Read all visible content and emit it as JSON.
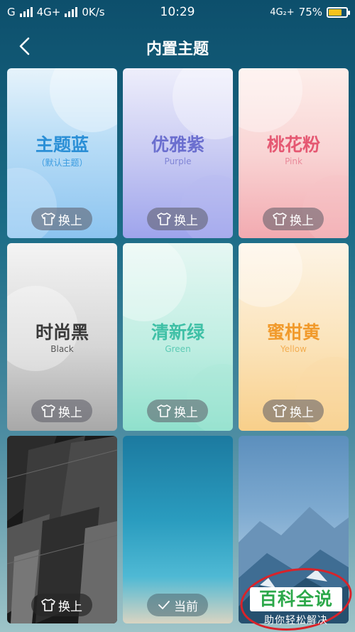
{
  "status_bar": {
    "carrier1": "G",
    "carrier2": "4G+",
    "speed": "0K/s",
    "time": "10:29",
    "network": "4G₂+",
    "battery": "75%",
    "battery_level": 0.75
  },
  "header": {
    "title": "内置主题"
  },
  "themes": [
    {
      "name": "主题蓝",
      "subtitle": "（默认主题）",
      "button": "换上",
      "name_color": "#2b8fd6"
    },
    {
      "name": "优雅紫",
      "subtitle": "Purple",
      "button": "换上",
      "name_color": "#6b6fcf"
    },
    {
      "name": "桃花粉",
      "subtitle": "Pink",
      "button": "换上",
      "name_color": "#e55872"
    },
    {
      "name": "时尚黑",
      "subtitle": "Black",
      "button": "换上",
      "name_color": "#3a3a3a"
    },
    {
      "name": "清新绿",
      "subtitle": "Green",
      "button": "换上",
      "name_color": "#3fc0a6"
    },
    {
      "name": "蜜柑黄",
      "subtitle": "Yellow",
      "button": "换上",
      "name_color": "#f19a2c"
    },
    {
      "name": "",
      "subtitle": "",
      "button": "换上"
    },
    {
      "name": "",
      "subtitle": "",
      "button": "当前"
    },
    {
      "name": "",
      "subtitle": "",
      "button": ""
    }
  ],
  "watermark": {
    "main": "百科全说",
    "sub": "助你轻松解决"
  }
}
